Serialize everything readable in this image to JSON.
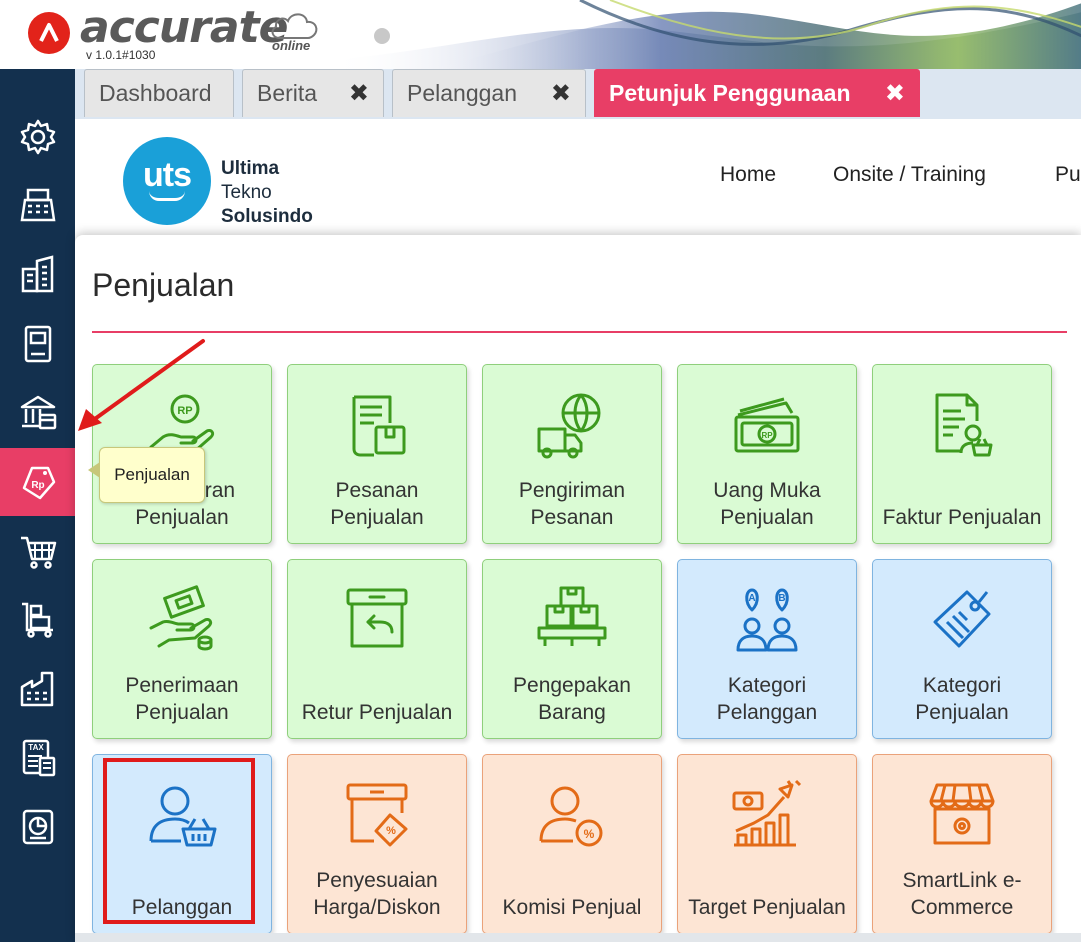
{
  "app": {
    "logo_text": "accurate",
    "logo_suffix": "online",
    "version": "v 1.0.1#1030"
  },
  "sidebar": {
    "items": [
      {
        "icon": "gear-icon"
      },
      {
        "icon": "cash-register-icon"
      },
      {
        "icon": "building-icon"
      },
      {
        "icon": "ledger-book-icon"
      },
      {
        "icon": "bank-icon"
      },
      {
        "icon": "sales-tag-icon",
        "badge": "Rp",
        "active": true
      },
      {
        "icon": "shopping-cart-icon"
      },
      {
        "icon": "inventory-cart-icon"
      },
      {
        "icon": "factory-icon"
      },
      {
        "icon": "tax-document-icon"
      },
      {
        "icon": "report-chart-icon"
      }
    ],
    "tooltip": "Penjualan"
  },
  "tabs": [
    {
      "label": "Dashboard",
      "closable": false
    },
    {
      "label": "Berita",
      "closable": true
    },
    {
      "label": "Pelanggan",
      "closable": true
    },
    {
      "label": "Petunjuk Penggunaan",
      "closable": true,
      "active": true
    }
  ],
  "tab_close_symbol": "✖",
  "website": {
    "brand_short": "uts",
    "brand_lines": [
      "Ultima",
      "Tekno",
      "Solusindo"
    ],
    "nav": [
      "Home",
      "Onsite / Training",
      "Pu"
    ]
  },
  "panel": {
    "title": "Penjualan",
    "cards": [
      {
        "label": "Penawaran Penjualan",
        "theme": "green",
        "icon": "hand-coin-icon"
      },
      {
        "label": "Pesanan Penjualan",
        "theme": "green",
        "icon": "order-document-icon"
      },
      {
        "label": "Pengiriman Pesanan",
        "theme": "green",
        "icon": "delivery-truck-icon"
      },
      {
        "label": "Uang Muka Penjualan",
        "theme": "green",
        "icon": "banknote-stack-icon"
      },
      {
        "label": "Faktur Penjualan",
        "theme": "green",
        "icon": "invoice-customer-icon"
      },
      {
        "label": "Penerimaan Penjualan",
        "theme": "green",
        "icon": "hand-money-icon"
      },
      {
        "label": "Retur Penjualan",
        "theme": "green",
        "icon": "return-box-icon"
      },
      {
        "label": "Pengepakan Barang",
        "theme": "green",
        "icon": "packed-boxes-icon"
      },
      {
        "label": "Kategori Pelanggan",
        "theme": "blue",
        "icon": "customer-category-icon"
      },
      {
        "label": "Kategori Penjualan",
        "theme": "blue",
        "icon": "price-tag-icon"
      },
      {
        "label": "Pelanggan",
        "theme": "blue",
        "icon": "customer-basket-icon"
      },
      {
        "label": "Penyesuaian Harga/Diskon",
        "theme": "orange",
        "icon": "discount-box-icon"
      },
      {
        "label": "Komisi Penjual",
        "theme": "orange",
        "icon": "sales-commission-icon"
      },
      {
        "label": "Target Penjualan",
        "theme": "orange",
        "icon": "growth-target-icon"
      },
      {
        "label": "SmartLink e-Commerce",
        "theme": "orange",
        "icon": "online-store-icon"
      }
    ]
  },
  "colors": {
    "sidebar_bg": "#13304e",
    "accent": "#e83e66",
    "green_card": "#dafbd4",
    "blue_card": "#d3eafd",
    "orange_card": "#fde5d4",
    "annotation_red": "#e01b1b"
  }
}
